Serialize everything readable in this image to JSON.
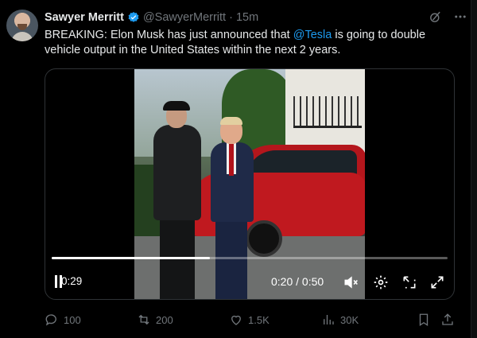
{
  "author": {
    "name": "Sawyer Merritt",
    "handle": "@SawyerMerritt",
    "separator": "·",
    "time": "15m"
  },
  "tweet": {
    "text_prefix": "BREAKING: Elon Musk has just announced that ",
    "mention": "@Tesla",
    "text_suffix": " is going to double vehicle output in the United States within the next 2 years."
  },
  "video": {
    "elapsed_left": "0:29",
    "time_readout": "0:20 / 0:50",
    "progress": 0.4
  },
  "actions": {
    "replies": "100",
    "reposts": "200",
    "likes": "1.5K",
    "views": "30K"
  },
  "colors": {
    "accent": "#1d9bf0",
    "muted": "#71767b",
    "text": "#e7e9ea",
    "background": "#000000"
  },
  "icons": {
    "verified": "verified-badge-icon",
    "grok": "grok-icon",
    "more": "more-icon",
    "reply": "reply-icon",
    "repost": "repost-icon",
    "like": "heart-icon",
    "views": "views-icon",
    "bookmark": "bookmark-icon",
    "share": "share-icon",
    "play": "play-pause-icon",
    "mute": "mute-icon",
    "settings": "settings-icon",
    "pip": "picture-in-picture-icon",
    "fullscreen": "fullscreen-icon"
  }
}
